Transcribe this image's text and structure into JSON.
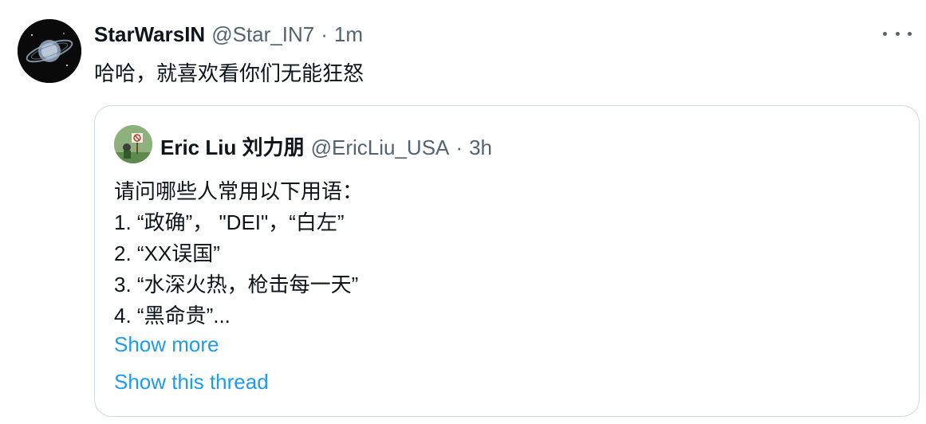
{
  "tweet": {
    "author_name": "StarWarsIN",
    "handle": "@Star_IN7",
    "separator": "·",
    "time": "1m",
    "text": "哈哈，就喜欢看你们无能狂怒",
    "avatar_icon": "planet-ring-avatar",
    "more_icon": "more-dots-icon"
  },
  "quoted": {
    "author_name": "Eric Liu 刘力朋",
    "handle": "@EricLiu_USA",
    "separator": "·",
    "time": "3h",
    "lines": [
      "请问哪些人常用以下用语：",
      "1. “政确”， \"DEI\"，“白左”",
      "2. “XX误国”",
      "3. “水深火热，枪击每一天”",
      "4. “黑命贵”..."
    ],
    "show_more": "Show more",
    "show_thread": "Show this thread"
  },
  "colors": {
    "text": "#0f1419",
    "secondary": "#536471",
    "link": "#1d9bf0",
    "border": "#cfd9de"
  }
}
